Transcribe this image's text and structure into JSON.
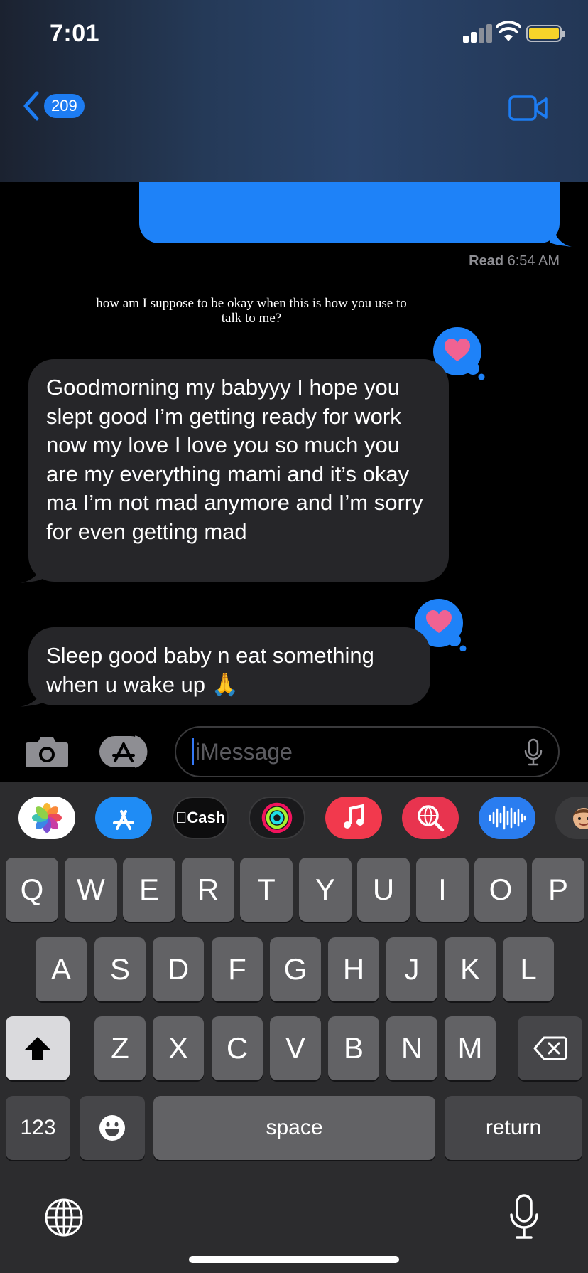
{
  "status_bar": {
    "time": "7:01"
  },
  "nav": {
    "unread_count": "209"
  },
  "colors": {
    "imessage_blue": "#1e82f8",
    "received_bubble": "#262629",
    "tapback_heart": "#f06292",
    "battery": "#f7d42a"
  },
  "conversation": {
    "read_receipt": {
      "label": "Read",
      "time": "6:54 AM"
    },
    "caption": "how am I suppose to be okay when this is how you use to talk to me?",
    "messages": [
      {
        "sender": "other",
        "text": "Goodmorning my babyyy I hope you slept good I’m getting ready for work now my love I love you so much you are my everything mami and it’s okay ma I’m not mad anymore and I’m sorry for even getting mad",
        "tapback": "heart-icon"
      },
      {
        "sender": "other",
        "text": "Sleep good baby n eat something when u wake up 🙏",
        "tapback": "heart-icon"
      }
    ]
  },
  "input": {
    "placeholder": "iMessage"
  },
  "app_strip": {
    "apps": [
      {
        "name": "photos-app-icon"
      },
      {
        "name": "app-store-app-icon"
      },
      {
        "name": "apple-cash-app-icon",
        "label": "Cash"
      },
      {
        "name": "activity-app-icon"
      },
      {
        "name": "music-app-icon"
      },
      {
        "name": "search-images-app-icon"
      },
      {
        "name": "audio-message-app-icon"
      },
      {
        "name": "memoji-app-icon"
      }
    ]
  },
  "keyboard": {
    "row1": [
      "Q",
      "W",
      "E",
      "R",
      "T",
      "Y",
      "U",
      "I",
      "O",
      "P"
    ],
    "row2": [
      "A",
      "S",
      "D",
      "F",
      "G",
      "H",
      "J",
      "K",
      "L"
    ],
    "row3": [
      "Z",
      "X",
      "C",
      "V",
      "B",
      "N",
      "M"
    ],
    "numbers_label": "123",
    "space_label": "space",
    "return_label": "return"
  }
}
